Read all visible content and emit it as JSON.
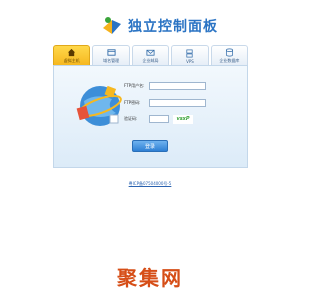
{
  "header": {
    "title": "独立控制面板"
  },
  "tabs": [
    {
      "label": "虚拟主机",
      "icon": "home-icon",
      "active": true
    },
    {
      "label": "域名管理",
      "icon": "domain-icon",
      "active": false
    },
    {
      "label": "企业邮局",
      "icon": "mail-icon",
      "active": false
    },
    {
      "label": "VPS",
      "icon": "server-icon",
      "active": false
    },
    {
      "label": "企业数据库",
      "icon": "database-icon",
      "active": false
    }
  ],
  "login": {
    "ftp_user_label": "FTP用户名:",
    "ftp_password_label": "FTP密码:",
    "captcha_label": "验证码:",
    "captcha_text": "vsxP",
    "button_label": "登录"
  },
  "footer": {
    "icp": "粤ICP备07504000号-5"
  },
  "watermark": "聚集网",
  "colors": {
    "accent": "#2f80d4",
    "active_tab": "#f6b820",
    "watermark": "#d64e17"
  }
}
